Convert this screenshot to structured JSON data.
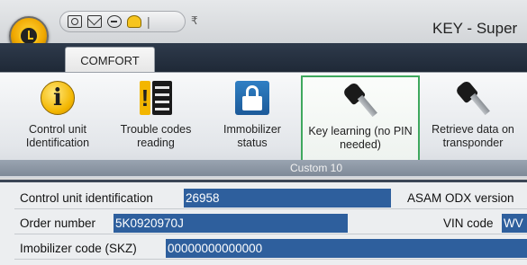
{
  "window": {
    "title": "KEY - Super"
  },
  "quick_access": {
    "icons": [
      "camera-icon",
      "mail-icon",
      "minus-circle-icon",
      "lightbulb-icon"
    ],
    "separator": "|",
    "dropdown": "₹"
  },
  "tabs": [
    {
      "label": "COMFORT",
      "active": true
    }
  ],
  "ribbon": {
    "buttons": [
      {
        "label": "Control unit Identification",
        "icon": "info-icon",
        "selected": false
      },
      {
        "label": "Trouble codes reading",
        "icon": "trouble-codes-icon",
        "selected": false
      },
      {
        "label": "Immobilizer status",
        "icon": "padlock-icon",
        "selected": false
      },
      {
        "label": "Key learning (no PIN needed)",
        "icon": "key-icon",
        "selected": true
      },
      {
        "label": "Retrieve data on transponder",
        "icon": "key-icon",
        "selected": false
      }
    ],
    "group_label": "Custom 10"
  },
  "fields": {
    "control_unit_identification": {
      "label": "Control unit identification",
      "value": "26958"
    },
    "asam_odx": {
      "label": "ASAM ODX version"
    },
    "order_number": {
      "label": "Order number",
      "value": "5K0920970J"
    },
    "vin_code": {
      "label": "VIN code",
      "value": "WV"
    },
    "immobilizer_code": {
      "label": "Imobilizer code (SKZ)",
      "value": "00000000000000"
    }
  },
  "colors": {
    "value_bg": "#2e5f9d",
    "selection_border": "#3fa85e",
    "tab_bar": "#1f2937",
    "orb": "#f3b600"
  }
}
